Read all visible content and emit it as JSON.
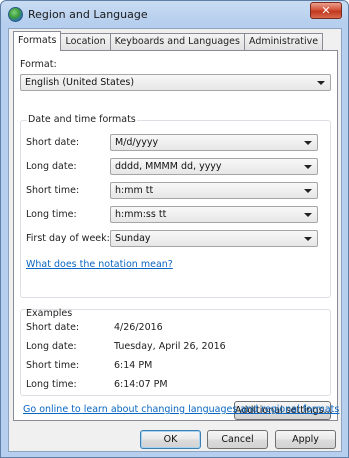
{
  "window": {
    "title": "Region and Language",
    "close_label": "✕"
  },
  "tabs": [
    "Formats",
    "Location",
    "Keyboards and Languages",
    "Administrative"
  ],
  "format": {
    "label": "Format:",
    "value": "English (United States)"
  },
  "datetime": {
    "title": "Date and time formats",
    "rows": [
      {
        "label": "Short date:",
        "value": "M/d/yyyy"
      },
      {
        "label": "Long date:",
        "value": "dddd, MMMM dd, yyyy"
      },
      {
        "label": "Short time:",
        "value": "h:mm tt"
      },
      {
        "label": "Long time:",
        "value": "h:mm:ss tt"
      },
      {
        "label": "First day of week:",
        "value": "Sunday"
      }
    ],
    "notation_link": "What does the notation mean?"
  },
  "examples": {
    "title": "Examples",
    "rows": [
      {
        "label": "Short date:",
        "value": "4/26/2016"
      },
      {
        "label": "Long date:",
        "value": "Tuesday, April 26, 2016"
      },
      {
        "label": "Short time:",
        "value": "6:14 PM"
      },
      {
        "label": "Long time:",
        "value": "6:14:07 PM"
      }
    ]
  },
  "additional_settings": "Additional settings...",
  "online_link": "Go online to learn about changing languages and regional formats",
  "buttons": {
    "ok": "OK",
    "cancel": "Cancel",
    "apply": "Apply"
  }
}
